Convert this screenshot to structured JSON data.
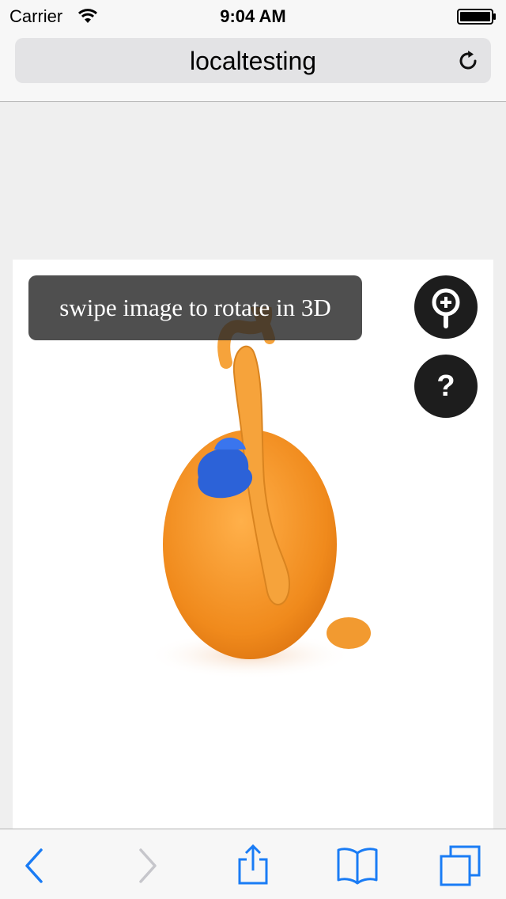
{
  "status_bar": {
    "carrier": "Carrier",
    "time": "9:04 AM"
  },
  "address_bar": {
    "url_text": "localtesting"
  },
  "viewer": {
    "hint_text": "swipe image to rotate in 3D",
    "help_glyph": "?"
  },
  "icons": {
    "wifi": "wifi-icon",
    "battery": "battery-icon",
    "reload": "reload-icon",
    "zoom": "magnifier-plus-icon",
    "help": "question-icon",
    "back": "chevron-left-icon",
    "forward": "chevron-right-icon",
    "share": "share-icon",
    "bookmarks": "book-icon",
    "tabs": "tabs-icon"
  },
  "colors": {
    "accent": "#1a7cf5",
    "disabled": "#c6c6cb",
    "overlay": "#2a2a2a",
    "plush_orange": "#f59b2e",
    "hat_blue": "#2c62d8"
  }
}
